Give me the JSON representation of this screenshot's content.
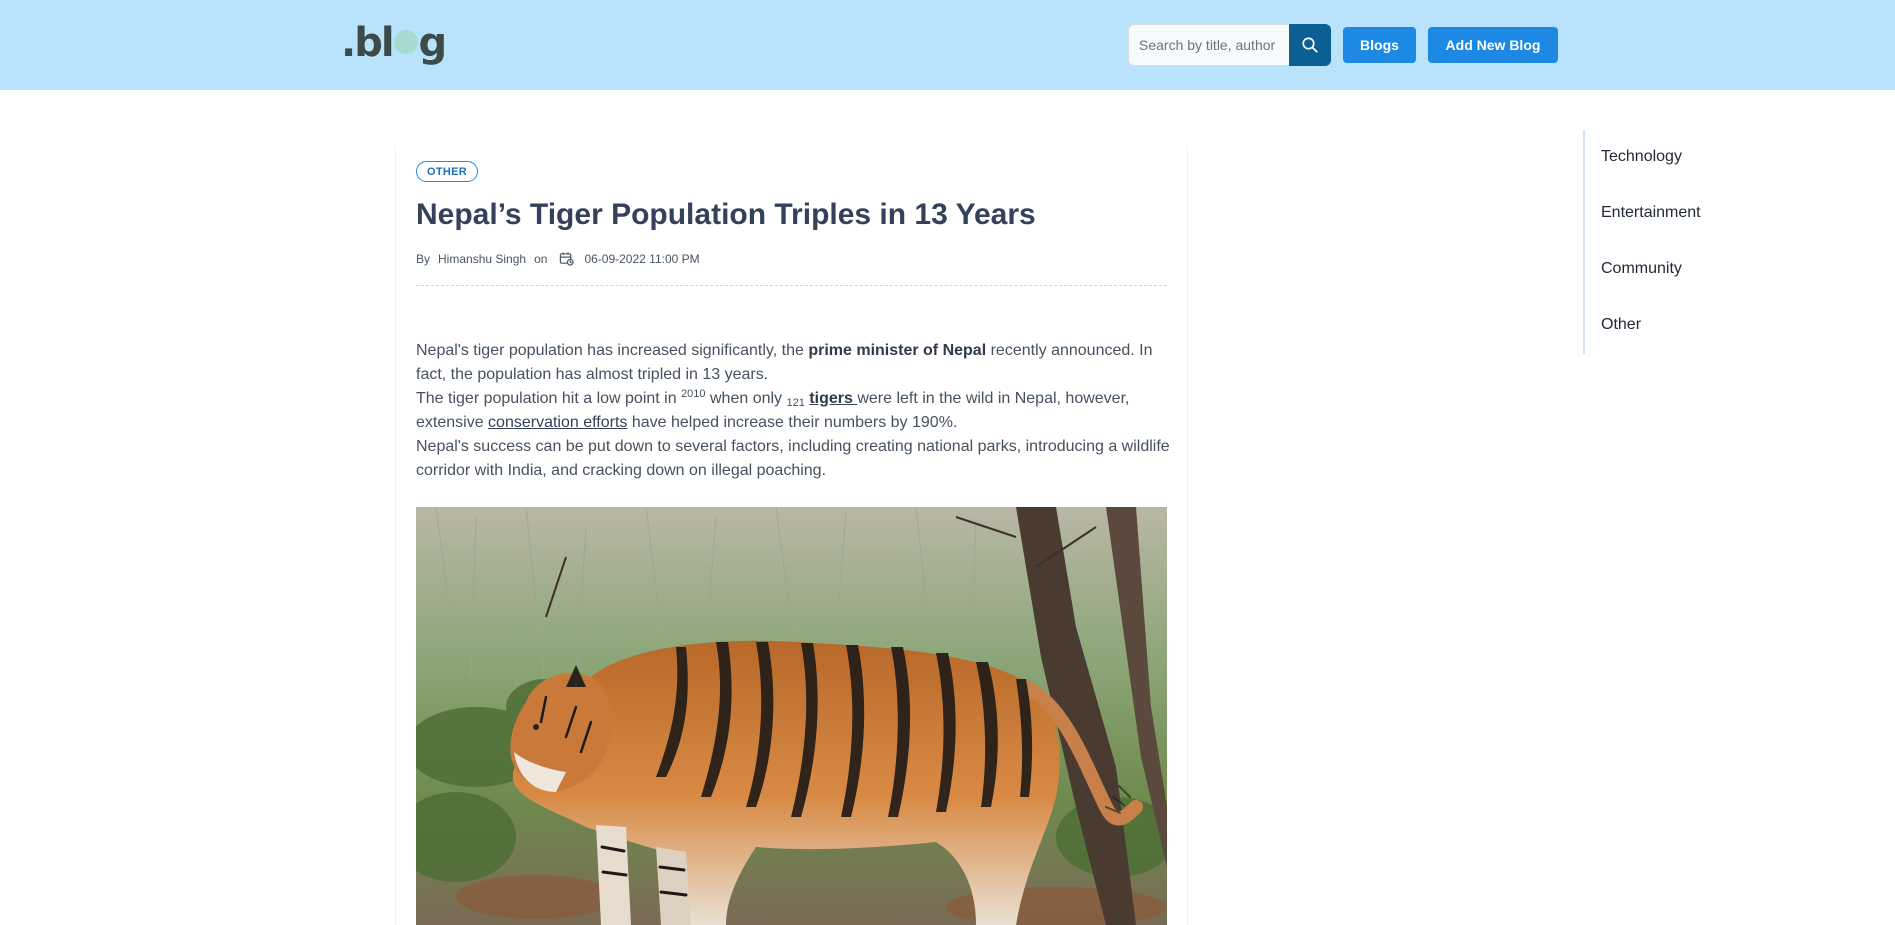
{
  "header": {
    "logo_text": ".blog",
    "search_placeholder": "Search by title, author",
    "search_icon": "search-icon",
    "blogs_label": "Blogs",
    "add_label": "Add New Blog"
  },
  "article": {
    "tag": "OTHER",
    "title": "Nepal’s Tiger Population Triples in 13 Years",
    "meta": {
      "by": "By",
      "author": "Himanshu Singh",
      "on": "on",
      "calendar_icon": "calendar-icon",
      "date": "06-09-2022 11:00 PM"
    },
    "p1": {
      "a": "Nepal's tiger population has increased significantly, the ",
      "bold": "prime minister of Nepal",
      "b": " recently announced. In fact, the population has almost tripled in 13 years."
    },
    "p2": {
      "a": "The tiger population hit a low point in ",
      "sup": "2010",
      "b": " when only ",
      "sub": "121",
      "link_bold": "tigers ",
      "c": "were left in the wild in Nepal, however, extensive ",
      "link": "conservation efforts",
      "d": " have helped increase their numbers by 190%."
    },
    "p3": "Nepal's success can be put down to several factors, including creating national parks, introducing a wildlife corridor with India, and cracking down on illegal poaching."
  },
  "sidebar": {
    "items": [
      {
        "label": "Technology"
      },
      {
        "label": "Entertainment"
      },
      {
        "label": "Community"
      },
      {
        "label": "Other"
      }
    ]
  },
  "colors": {
    "header_bg": "#b9e3fa",
    "accent": "#1e88e5",
    "search_button": "#0b5f93"
  }
}
